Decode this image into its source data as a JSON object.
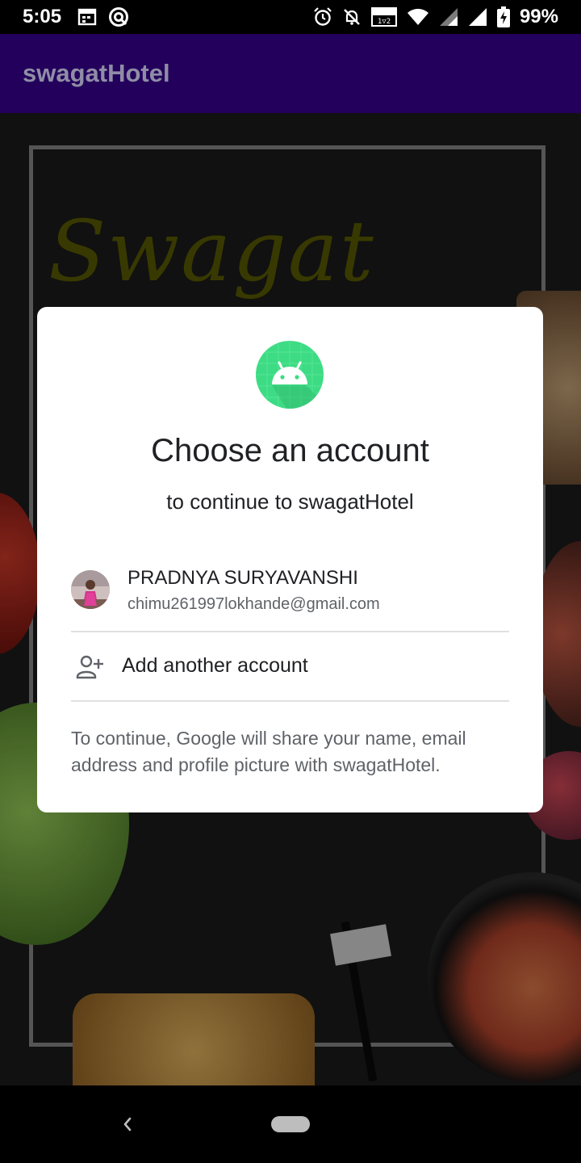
{
  "status_bar": {
    "time": "5:05",
    "battery_percent": "99%",
    "icons": [
      "calendar-icon",
      "at-icon",
      "alarm-icon",
      "mute-icon",
      "vowifi-icon",
      "wifi-icon",
      "signal-icon",
      "signal-icon",
      "battery-icon"
    ]
  },
  "app_bar": {
    "title": "swagatHotel"
  },
  "background": {
    "title": "Swagat Hotel"
  },
  "dialog": {
    "title": "Choose an account",
    "subtitle": "to continue to swagatHotel",
    "account": {
      "name": "PRADNYA SURYAVANSHI",
      "email": "chimu261997lokhande@gmail.com"
    },
    "add_account_label": "Add another account",
    "note": "To continue, Google will share your name, email address and profile picture with swagatHotel."
  },
  "colors": {
    "app_bar": "#23005b",
    "android_green": "#3ddc84",
    "dialog_bg": "#ffffff"
  }
}
